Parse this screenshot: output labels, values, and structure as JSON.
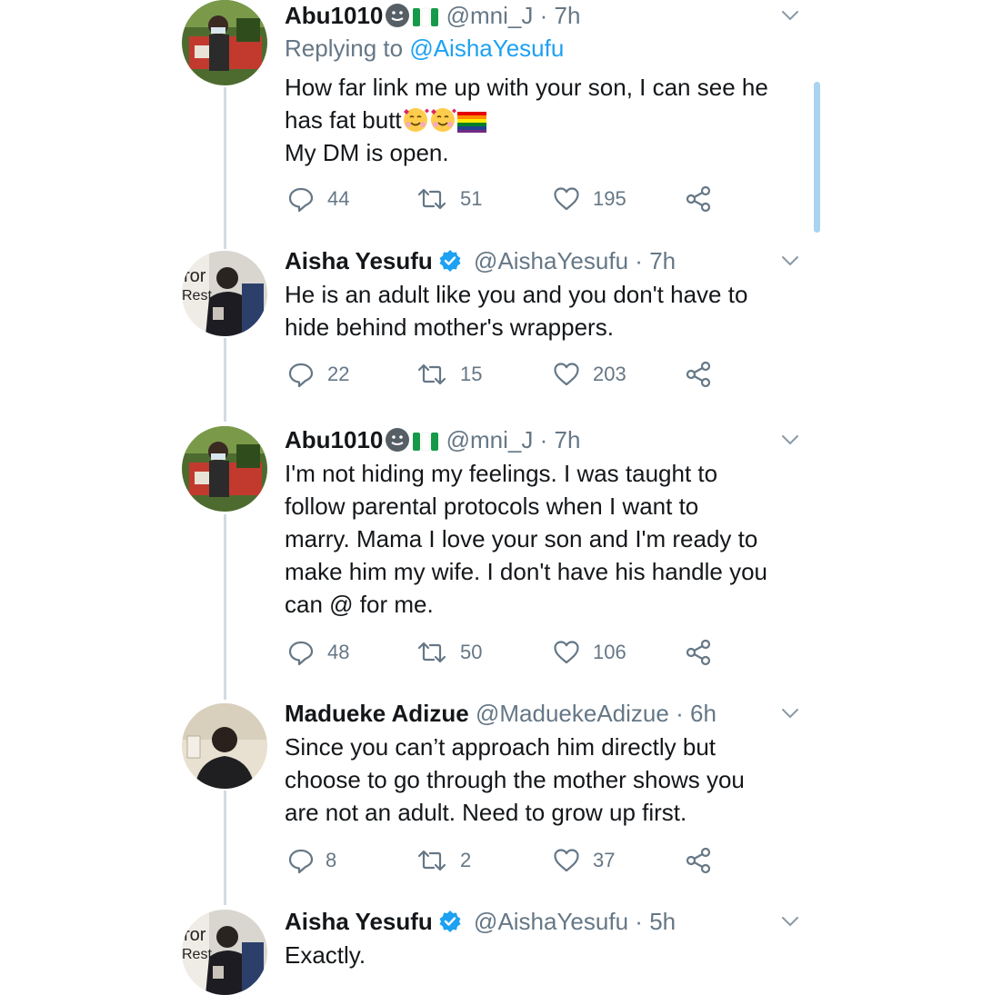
{
  "tweets": [
    {
      "name": "Abu1010",
      "handle": "@mni_J",
      "sep": "·",
      "time": "7h",
      "reply_prefix": "Replying to ",
      "reply_to": "@AishaYesufu",
      "lines": [
        "How far link me up with your son, I can see he",
        "has fat butt",
        "My DM is open."
      ],
      "emojis": [
        "smiling-face-with-hearts",
        "smiling-face-with-hearts",
        "rainbow-flag"
      ],
      "replies": "44",
      "retweets": "51",
      "likes": "195"
    },
    {
      "name": "Aisha Yesufu",
      "handle": "@AishaYesufu",
      "sep": "·",
      "time": "7h",
      "verified": true,
      "lines": [
        "He is an adult like you and you don't have to",
        "hide behind mother's wrappers."
      ],
      "replies": "22",
      "retweets": "15",
      "likes": "203"
    },
    {
      "name": "Abu1010",
      "handle": "@mni_J",
      "sep": "·",
      "time": "7h",
      "lines": [
        "I'm not hiding my feelings. I was taught to",
        "follow parental protocols when I want to",
        "marry. Mama I love your son and I'm ready to",
        "make him my wife. I don't have his handle you",
        "can @ for me."
      ],
      "replies": "48",
      "retweets": "50",
      "likes": "106"
    },
    {
      "name": "Madueke Adizue",
      "handle": "@MaduekeAdizue",
      "sep": "·",
      "time": "6h",
      "lines": [
        "Since you can’t approach him directly but",
        "choose to go through the mother shows you",
        "are not an adult. Need to grow up first."
      ],
      "replies": "8",
      "retweets": "2",
      "likes": "37"
    },
    {
      "name": "Aisha Yesufu",
      "handle": "@AishaYesufu",
      "sep": "·",
      "time": "5h",
      "verified": true,
      "lines": [
        "Exactly."
      ]
    }
  ],
  "icons": {
    "reply": "reply-icon",
    "retweet": "retweet-icon",
    "like": "like-icon",
    "share": "share-icon",
    "more": "chevron-down-icon",
    "verified": "verified-badge-icon",
    "status": "face-emoji-icon",
    "flag": "nigeria-flag-icon"
  },
  "colors": {
    "accent": "#1da1f2",
    "text": "#14171a",
    "secondary": "#657786",
    "thread_line": "#d3dbe2"
  }
}
